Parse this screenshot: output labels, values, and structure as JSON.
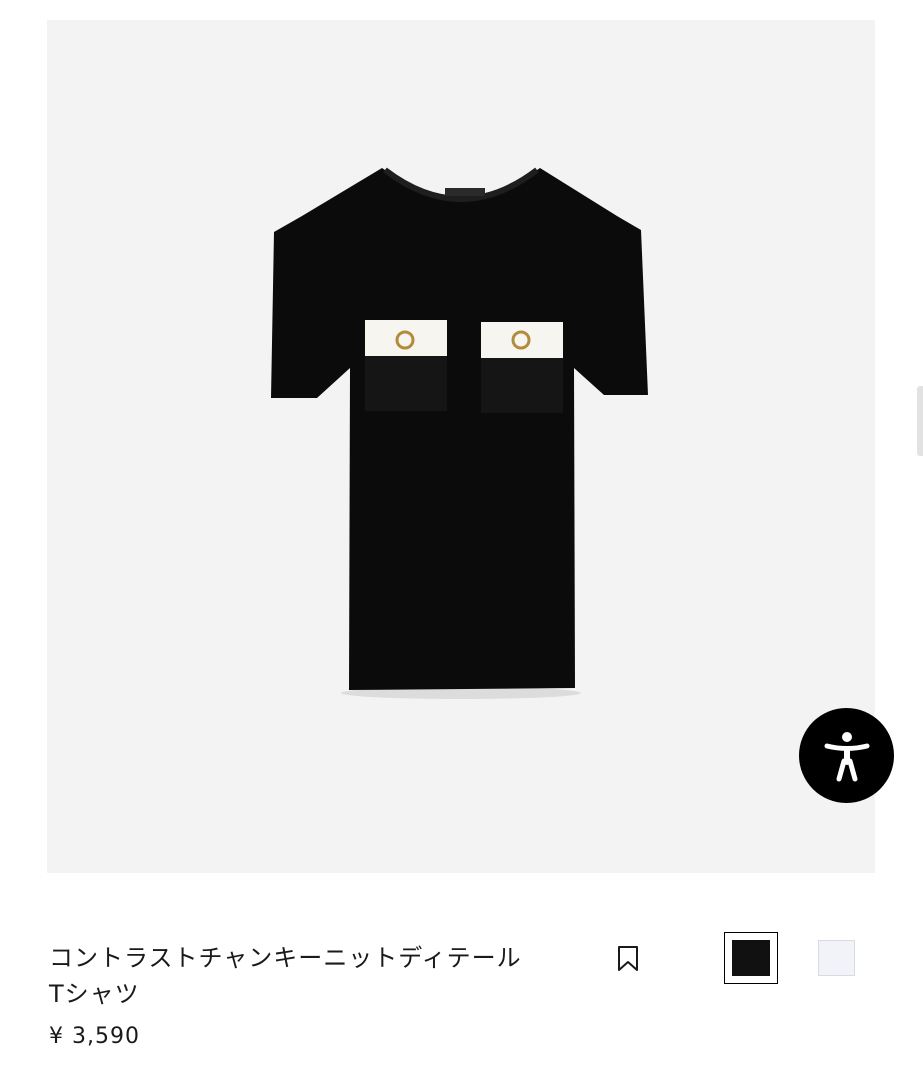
{
  "product": {
    "title_line1": "コントラストチャンキーニットディテール",
    "title_line2": "Tシャツ",
    "price": "¥ 3,590",
    "image_icon": "tshirt-product-photo"
  },
  "colors": {
    "options": [
      {
        "name": "black",
        "hex": "#111111",
        "selected": true
      },
      {
        "name": "white",
        "hex": "#f2f3f8",
        "selected": false
      }
    ]
  },
  "icons": {
    "bookmark": "bookmark-icon",
    "accessibility": "accessibility-icon"
  }
}
